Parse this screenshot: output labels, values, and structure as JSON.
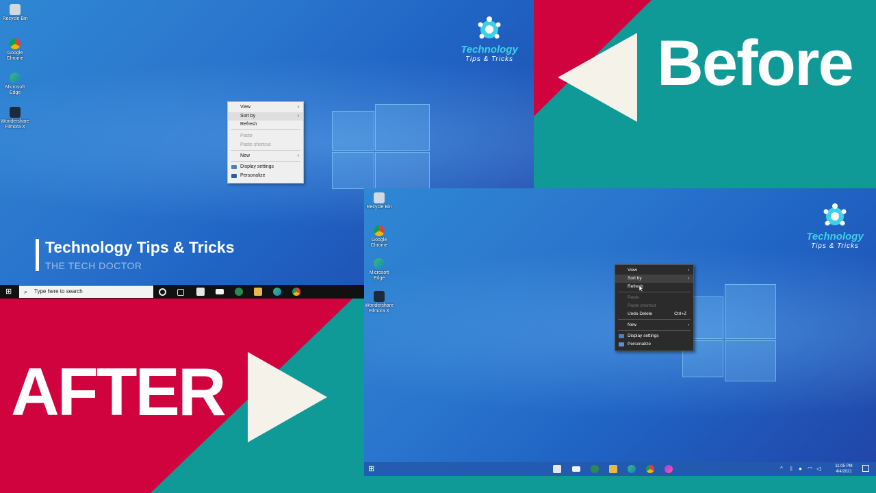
{
  "brand": {
    "logo_line1": "Technology",
    "logo_line2": "Tips & Tricks",
    "caption_title": "Technology Tips & Tricks",
    "caption_subtitle": "THE TECH DOCTOR",
    "before_label": "Before",
    "after_label": "AFTER",
    "colors": {
      "teal": "#0f9a98",
      "red": "#d0033f",
      "white": "#ffffff",
      "logo_cyan": "#3fd0e6"
    }
  },
  "before": {
    "desktop_icons": [
      {
        "label": "Recycle Bin",
        "icon": "recycle-bin-icon"
      },
      {
        "label": "Google Chrome",
        "icon": "chrome-icon"
      },
      {
        "label": "Microsoft Edge",
        "icon": "edge-icon"
      },
      {
        "label": "Wondershare Filmora X",
        "icon": "filmora-icon"
      }
    ],
    "context_menu": {
      "items": [
        {
          "label": "View",
          "submenu": true
        },
        {
          "label": "Sort by",
          "submenu": true,
          "highlighted": true
        },
        {
          "label": "Refresh"
        },
        {
          "label": "Paste",
          "disabled": true
        },
        {
          "label": "Paste shortcut",
          "disabled": true
        },
        {
          "label": "New",
          "submenu": true
        },
        {
          "label": "Display settings",
          "icon": "display-icon"
        },
        {
          "label": "Personalize",
          "icon": "personalize-icon"
        }
      ]
    },
    "taskbar": {
      "search_placeholder": "Type here to search",
      "icons": [
        "windows-start-icon",
        "cortana-icon",
        "task-view-icon",
        "store-icon",
        "mail-icon",
        "camtasia-icon",
        "file-explorer-icon",
        "edge-icon",
        "chrome-icon"
      ]
    }
  },
  "after": {
    "desktop_icons": [
      {
        "label": "Recycle Bin",
        "icon": "recycle-bin-icon"
      },
      {
        "label": "Google Chrome",
        "icon": "chrome-icon"
      },
      {
        "label": "Microsoft Edge",
        "icon": "edge-icon"
      },
      {
        "label": "Wondershare Filmora X",
        "icon": "filmora-icon"
      }
    ],
    "context_menu": {
      "items": [
        {
          "label": "View",
          "submenu": true
        },
        {
          "label": "Sort by",
          "submenu": true,
          "highlighted": true
        },
        {
          "label": "Refresh"
        },
        {
          "label": "Paste",
          "disabled": true
        },
        {
          "label": "Paste shortcut",
          "disabled": true
        },
        {
          "label": "Undo Delete",
          "shortcut": "Ctrl+Z"
        },
        {
          "label": "New",
          "submenu": true
        },
        {
          "label": "Display settings",
          "icon": "display-icon"
        },
        {
          "label": "Personalize",
          "icon": "personalize-icon"
        }
      ]
    },
    "taskbar": {
      "icons": [
        "windows-start-icon",
        "store-icon",
        "mail-icon",
        "camtasia-icon",
        "file-explorer-icon",
        "edge-icon",
        "chrome-icon",
        "messenger-icon"
      ],
      "tray_time": "11:05 PM",
      "tray_date": "4/4/2021"
    }
  }
}
